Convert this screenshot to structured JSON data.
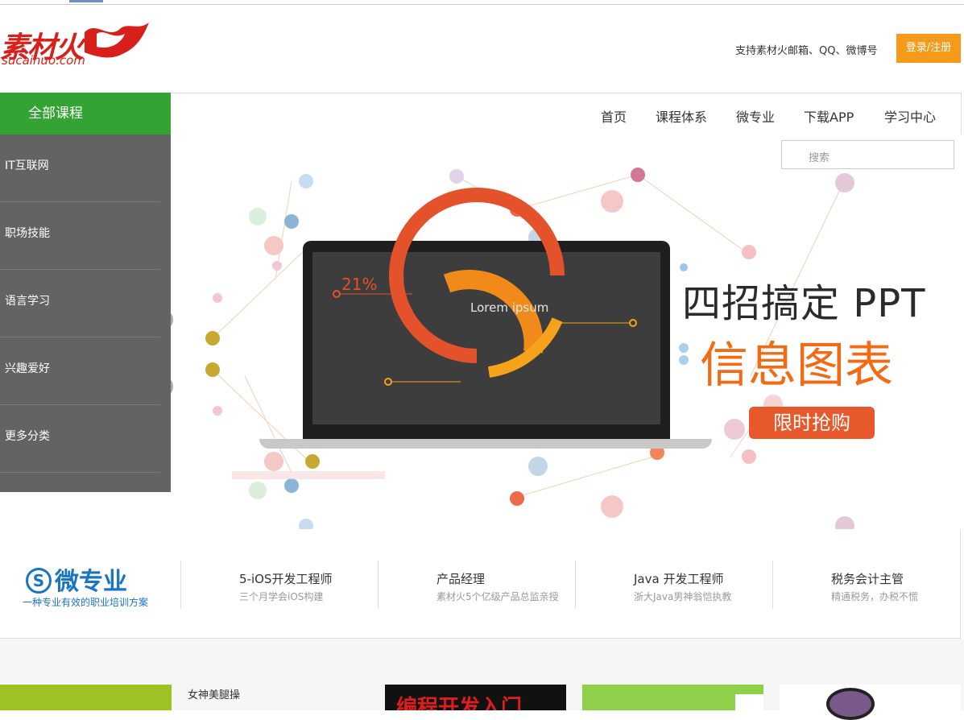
{
  "header": {
    "logo_text": "素材火",
    "logo_sub": "sucaihuo.com",
    "support_text": "支持素材火邮箱、QQ、微博号",
    "login_label": "登录/注册"
  },
  "nav": {
    "all_courses": "全部课程",
    "items": [
      "首页",
      "课程体系",
      "微专业",
      "下载APP",
      "学习中心"
    ]
  },
  "sidebar": {
    "items": [
      "IT互联网",
      "职场技能",
      "语言学习",
      "兴趣爱好",
      "更多分类"
    ]
  },
  "search": {
    "placeholder": "搜索"
  },
  "banner": {
    "headline": "四招搞定 PPT",
    "subheadline": "信息图表",
    "promo": "限时抢购",
    "screen_percent": "21%",
    "screen_title": "Lorem ipsum"
  },
  "micro": {
    "logo": "微专业",
    "logo_mark": "S",
    "tagline": "一种专业有效的职业培训方案",
    "courses": [
      {
        "title": "5-iOS开发工程师",
        "sub": "三个月学会iOS构建"
      },
      {
        "title": "产品经理",
        "sub": "素材火5个亿级产品总监亲授"
      },
      {
        "title": "Java 开发工程师",
        "sub": "浙大Java男神翁恺执教"
      },
      {
        "title": "税务会计主管",
        "sub": "精通税务，办税不慌"
      }
    ]
  },
  "lower": {
    "card_title": "女神美腿操",
    "dark_card_text": "编程开发入门"
  },
  "colors": {
    "green": "#33a333",
    "orange": "#f79a19",
    "sidebar": "#636363",
    "brand_red": "#d8201b",
    "micro_blue": "#1a74c6"
  }
}
